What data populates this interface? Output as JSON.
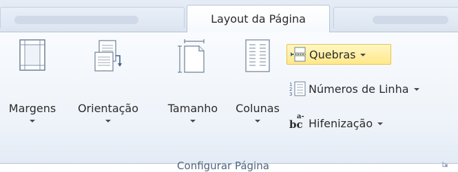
{
  "tabs": {
    "active_label": "Layout da Página"
  },
  "group": {
    "label": "Configurar Página",
    "big_buttons": [
      {
        "label": "Margens",
        "icon": "margins-icon"
      },
      {
        "label": "Orientação",
        "icon": "orientation-icon"
      },
      {
        "label": "Tamanho",
        "icon": "size-icon"
      },
      {
        "label": "Colunas",
        "icon": "columns-icon"
      }
    ],
    "small_buttons": [
      {
        "label": "Quebras",
        "icon": "breaks-icon",
        "highlighted": true
      },
      {
        "label": "Números de Linha",
        "icon": "line-numbers-icon"
      },
      {
        "label": "Hifenização",
        "icon": "hyphenation-icon"
      }
    ],
    "hyphen_glyph": "bc",
    "hyphen_glyph_super": "a-"
  },
  "colors": {
    "highlight": "#ffe98a",
    "highlight_border": "#e6c24a",
    "group_label": "#50647e"
  }
}
